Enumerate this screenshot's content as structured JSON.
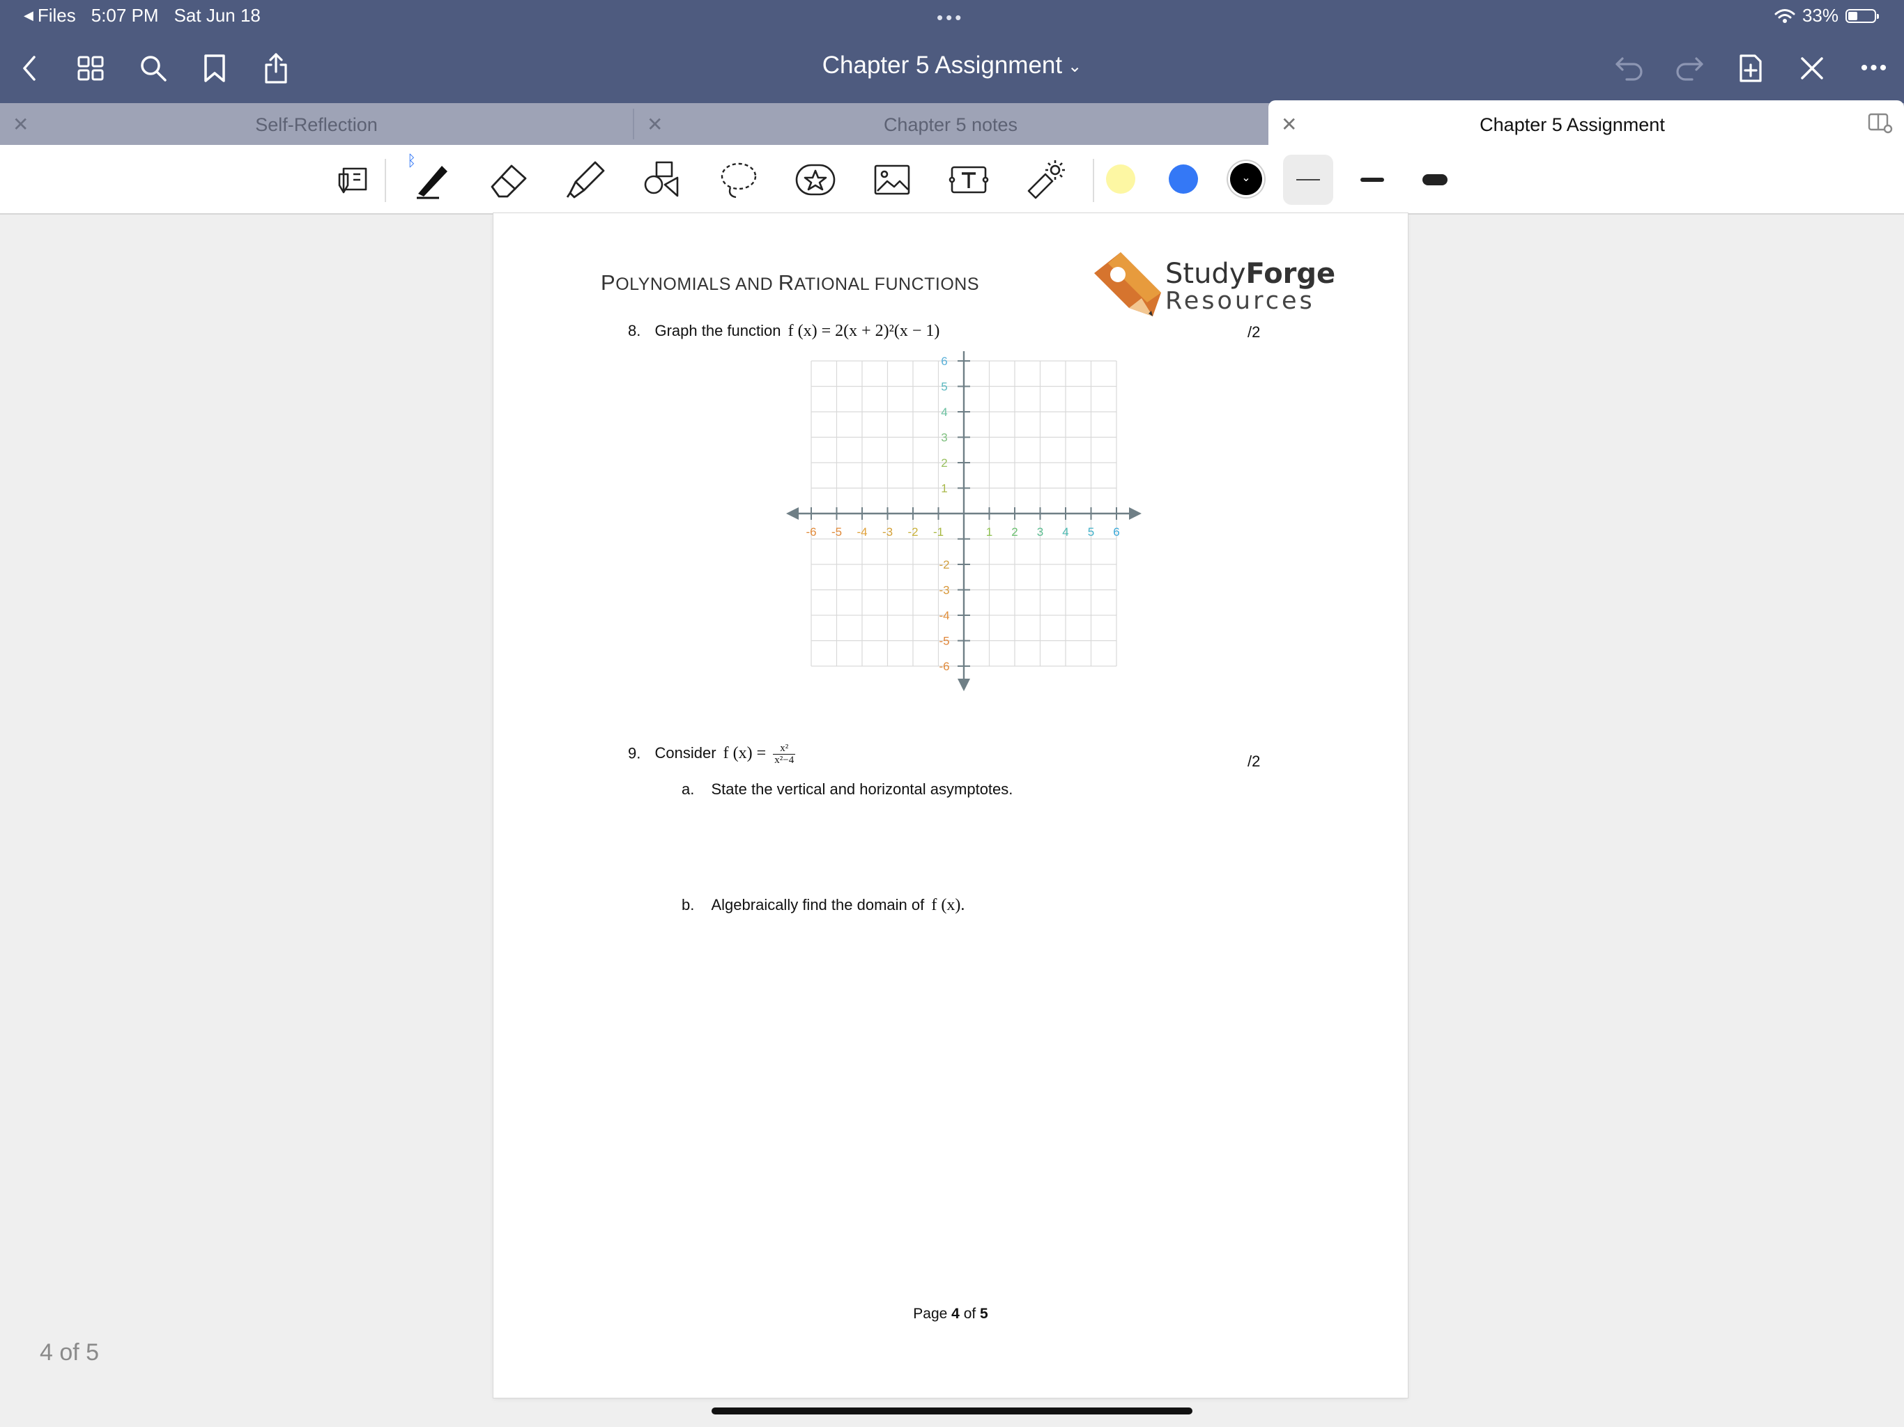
{
  "status_bar": {
    "back_app": "Files",
    "time": "5:07 PM",
    "date": "Sat Jun 18",
    "battery": "33%"
  },
  "nav": {
    "title": "Chapter 5 Assignment"
  },
  "tabs": [
    {
      "label": "Self-Reflection",
      "active": false
    },
    {
      "label": "Chapter 5 notes",
      "active": false
    },
    {
      "label": "Chapter 5 Assignment",
      "active": true
    }
  ],
  "toolbar": {
    "tools": [
      "scroll-select-icon",
      "pen-icon",
      "eraser-icon",
      "highlighter-icon",
      "shapes-icon",
      "lasso-icon",
      "sticker-icon",
      "image-icon",
      "text-box-icon",
      "laser-pointer-icon"
    ],
    "colors": [
      "#fdf7a3",
      "#3478f6",
      "#000000"
    ],
    "stroke_widths": [
      "thin",
      "medium",
      "thick"
    ]
  },
  "document": {
    "title_big1": "P",
    "title_small1": "OLYNOMIALS AND ",
    "title_big2": "R",
    "title_small2": "ATIONAL FUNCTIONS",
    "logo_word_study": "Study",
    "logo_word_forge": "Forge",
    "logo_word_resources": "Resources",
    "q8_number": "8.",
    "q8_text": "Graph the function",
    "q8_math": "f (x) = 2(x + 2)²(x − 1)",
    "q8_score": "/2",
    "graph_x_labels": [
      "-6",
      "-5",
      "-4",
      "-3",
      "-2",
      "-1",
      "1",
      "2",
      "3",
      "4",
      "5",
      "6"
    ],
    "graph_y_labels": [
      "6",
      "5",
      "4",
      "3",
      "2",
      "1",
      "-2",
      "-3",
      "-4",
      "-5",
      "-6"
    ],
    "q9_number": "9.",
    "q9_text": "Consider",
    "q9_math_lhs": "f (x) =",
    "q9_num": "x²",
    "q9_den": "x²−4",
    "q9_score": "/2",
    "q9a_letter": "a.",
    "q9a_text": "State the vertical and horizontal asymptotes.",
    "q9b_letter": "b.",
    "q9b_text": "Algebraically find the domain of",
    "q9b_math": "f (x).",
    "footer_page": "Page",
    "footer_cur": "4",
    "footer_of": "of",
    "footer_total": "5"
  },
  "page_counter": "4 of 5"
}
